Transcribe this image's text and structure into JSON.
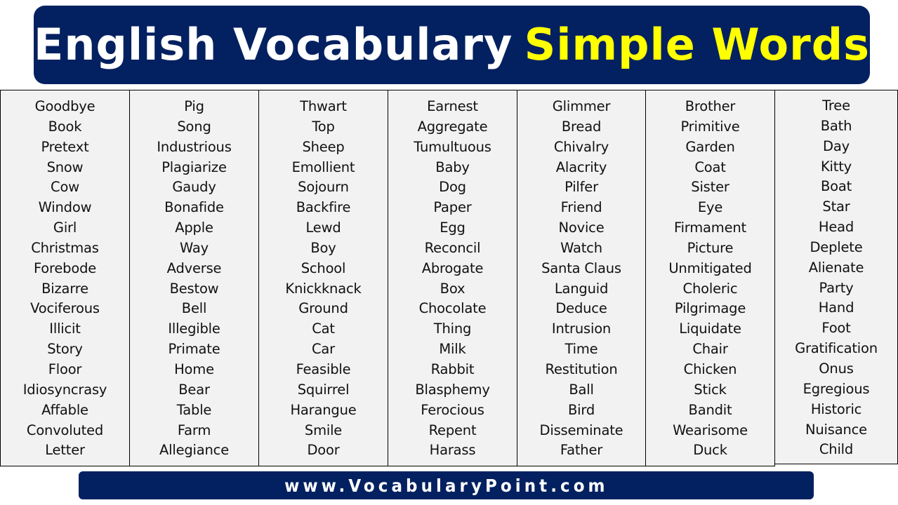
{
  "title": {
    "part_white": "English Vocabulary",
    "part_yellow": "Simple Words"
  },
  "colors": {
    "banner_bg": "#032160",
    "title_white": "#ffffff",
    "title_yellow": "#ffff00",
    "table_bg": "#f2f2f2",
    "border": "#000000"
  },
  "columns": [
    [
      "Goodbye",
      "Book",
      "Pretext",
      "Snow",
      "Cow",
      "Window",
      "Girl",
      "Christmas",
      "Forebode",
      "Bizarre",
      "Vociferous",
      "Illicit",
      "Story",
      "Floor",
      "Idiosyncrasy",
      "Affable",
      "Convoluted",
      "Letter"
    ],
    [
      "Pig",
      "Song",
      "Industrious",
      "Plagiarize",
      "Gaudy",
      "Bonafide",
      "Apple",
      "Way",
      "Adverse",
      "Bestow",
      "Bell",
      "Illegible",
      "Primate",
      "Home",
      "Bear",
      "Table",
      "Farm",
      "Allegiance"
    ],
    [
      "Thwart",
      "Top",
      "Sheep",
      "Emollient",
      "Sojourn",
      "Backfire",
      "Lewd",
      "Boy",
      "School",
      "Knickknack",
      "Ground",
      "Cat",
      "Car",
      "Feasible",
      "Squirrel",
      "Harangue",
      "Smile",
      "Door"
    ],
    [
      "Earnest",
      "Aggregate",
      "Tumultuous",
      "Baby",
      "Dog",
      "Paper",
      "Egg",
      "Reconcil",
      "Abrogate",
      "Box",
      "Chocolate",
      "Thing",
      "Milk",
      "Rabbit",
      "Blasphemy",
      "Ferocious",
      "Repent",
      "Harass"
    ],
    [
      "Glimmer",
      "Bread",
      "Chivalry",
      "Alacrity",
      "Pilfer",
      "Friend",
      "Novice",
      "Watch",
      "Santa Claus",
      "Languid",
      "Deduce",
      "Intrusion",
      "Time",
      "Restitution",
      "Ball",
      "Bird",
      "Disseminate",
      "Father"
    ],
    [
      "Brother",
      "Primitive",
      "Garden",
      "Coat",
      "Sister",
      "Eye",
      "Firmament",
      "Picture",
      "Unmitigated",
      "Choleric",
      "Pilgrimage",
      "Liquidate",
      "Chair",
      "Chicken",
      "Stick",
      "Bandit",
      "Wearisome",
      "Duck"
    ],
    [
      "Tree",
      "Bath",
      "Day",
      "Kitty",
      "Boat",
      "Star",
      "Head",
      "Deplete",
      "Alienate",
      "Party",
      "Hand",
      "Foot",
      "Gratification",
      "Onus",
      "Egregious",
      "Historic",
      "Nuisance",
      "Child"
    ]
  ],
  "footer": {
    "website": "www.VocabularyPoint.com"
  }
}
